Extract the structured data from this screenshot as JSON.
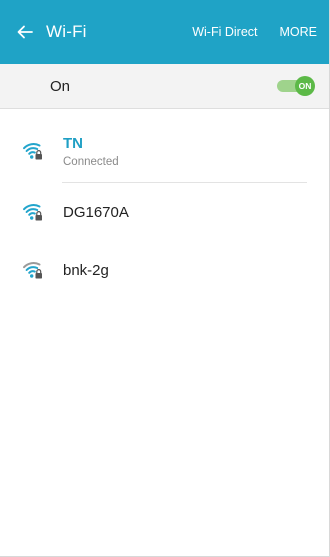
{
  "appbar": {
    "title": "Wi-Fi",
    "back_icon": "arrow-left-icon",
    "wifi_direct_label": "Wi-Fi Direct",
    "more_label": "MORE",
    "color": "#1fa3c6"
  },
  "toggle": {
    "label": "On",
    "switch_text": "ON",
    "state": "on",
    "color": "#5cb947"
  },
  "networks": [
    {
      "name": "TN",
      "status": "Connected",
      "icon": "wifi-locked-icon"
    },
    {
      "name": "DG1670A",
      "status": "",
      "icon": "wifi-locked-icon"
    },
    {
      "name": "bnk-2g",
      "status": "",
      "icon": "wifi-locked-icon"
    }
  ]
}
